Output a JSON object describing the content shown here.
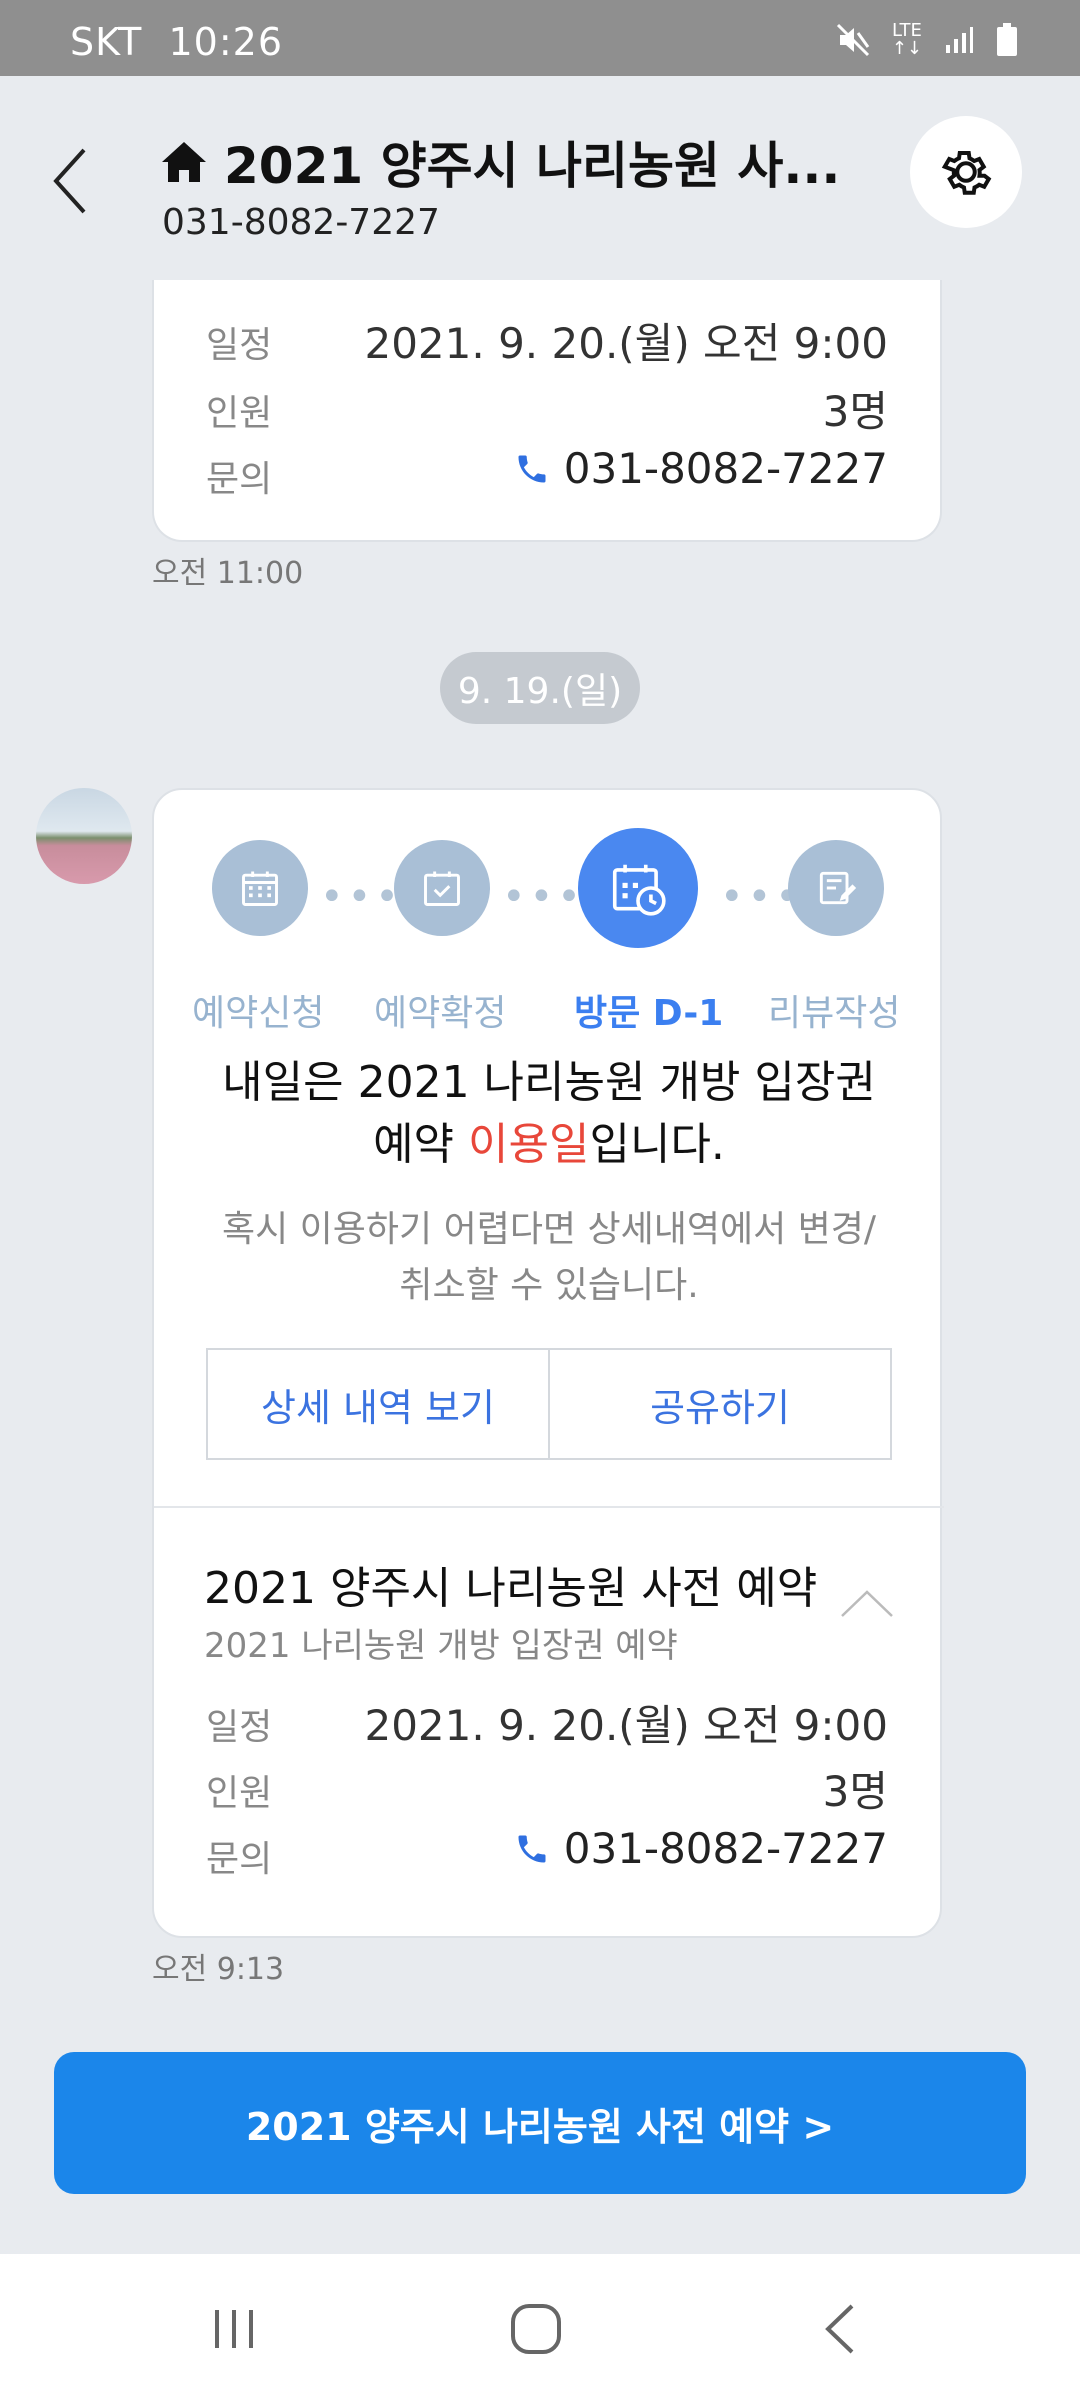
{
  "status_bar": {
    "carrier": "SKT",
    "time": "10:26",
    "icons": [
      "mute-icon",
      "lte-icon",
      "signal-icon",
      "battery-icon"
    ],
    "lte_label": "LTE"
  },
  "header": {
    "title": "2021 양주시 나리농원 사...",
    "phone": "031-8082-7227",
    "icons": [
      "back-icon",
      "home-icon",
      "gear-icon"
    ]
  },
  "first_card": {
    "rows": [
      {
        "label": "일정",
        "value": "2021. 9. 20.(월) 오전 9:00"
      },
      {
        "label": "인원",
        "value": "3명"
      },
      {
        "label": "문의",
        "value": "031-8082-7227"
      }
    ],
    "time": "오전 11:00"
  },
  "date_separator": "9. 19.(일)",
  "main_card": {
    "steps": [
      {
        "label": "예약신청",
        "icon": "calendar-icon"
      },
      {
        "label": "예약확정",
        "icon": "calendar-check-icon"
      },
      {
        "label": "방문 D-1",
        "icon": "calendar-clock-icon"
      },
      {
        "label": "리뷰작성",
        "icon": "review-edit-icon"
      }
    ],
    "message_line1": "내일은 2021 나리농원 개방 입장권",
    "message_line2_prefix": "예약 ",
    "message_highlight": "이용일",
    "message_line2_suffix": "입니다.",
    "sub_line1": "혹시 이용하기 어렵다면 상세내역에서 변경/",
    "sub_line2": "취소할 수 있습니다.",
    "detail_button": "상세 내역 보기",
    "share_button": "공유하기",
    "booking_title": "2021 양주시 나리농원 사전 예약",
    "booking_desc": "2021 나리농원 개방 입장권 예약",
    "rows": [
      {
        "label": "일정",
        "value": "2021. 9. 20.(월) 오전 9:00"
      },
      {
        "label": "인원",
        "value": "3명"
      },
      {
        "label": "문의",
        "value": "031-8082-7227"
      }
    ],
    "time": "오전 9:13"
  },
  "cta_button": "2021 양주시 나리농원 사전 예약 >",
  "colors": {
    "accent": "#1b86ea",
    "active_step": "#4a88f0",
    "inactive_step": "#a9bfd6",
    "highlight_red": "#e8473a",
    "background": "#e8ebef"
  }
}
